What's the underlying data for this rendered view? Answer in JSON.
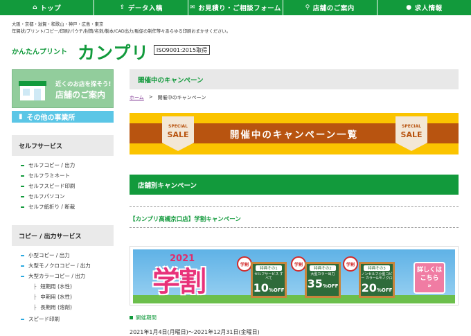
{
  "nav": [
    {
      "label": "トップ",
      "icon": "home-icon",
      "glyph": "⌂"
    },
    {
      "label": "データ入稿",
      "icon": "upload-icon",
      "glyph": "⇪"
    },
    {
      "label": "お見積り・ご相談フォーム",
      "icon": "mail-icon",
      "glyph": "✉"
    },
    {
      "label": "店舗のご案内",
      "icon": "search-icon",
      "glyph": "⚲"
    },
    {
      "label": "求人情報",
      "icon": "person-icon",
      "glyph": "●"
    }
  ],
  "header": {
    "tagline1": "大阪・京都・滋賀・和歌山・神戸・広島・東京",
    "tagline2": "年賀状/プリント/コピー/印刷/パウチ/封筒/名刺/製本/CAD出力/販促の制作等々あらゆる印刷おまかせください。",
    "brand_small": "かんたんプリント",
    "brand_big": "カンプリ",
    "iso": "ISO9001:2015取得"
  },
  "sidebar": {
    "store_banner_small": "近くのお店を探そう!",
    "store_banner_big": "店舗のご案内",
    "office_button": "その他の事業所",
    "self_service": {
      "heading": "セルフサービス",
      "items": [
        "セルフコピー / 出力",
        "セルフラミネート",
        "セルフスピード印刷",
        "セルフパソコン",
        "セルフ紙折り / 断裁"
      ]
    },
    "copy_output": {
      "heading": "コピー / 出力サービス",
      "items": [
        "小型コピー / 出力",
        "大型モノクロコピー / 出力",
        "大型カラーコピー / 出力"
      ],
      "subitems": [
        "短期用 (水性)",
        "中期用 (水性)",
        "長期用 (溶剤)"
      ],
      "after": [
        "スピード印刷"
      ]
    }
  },
  "main": {
    "heading": "開催中のキャンペーン",
    "breadcrumb_home": "ホーム",
    "breadcrumb_sep": ">",
    "breadcrumb_current": "開催中のキャンペーン",
    "banner_text": "開催中のキャンペーン一覧",
    "sale_tag_top": "SPECIAL",
    "sale_tag_main": "SALE",
    "store_campaigns_heading": "店舗別キャンペーン",
    "campaign_title": "【カンプリ高槻京口店】学割キャンペーン",
    "promo": {
      "year": "2021",
      "title": "学割",
      "seal": "学割",
      "boards": [
        {
          "tok": "特典その1",
          "desc": "セルフサービス すべて",
          "pct": "10",
          "unit": "%OFF"
        },
        {
          "tok": "特典その2",
          "desc": "大型カラー出力",
          "pct": "35",
          "unit": "%OFF"
        },
        {
          "tok": "特典その3",
          "desc": "ノンセルフ小型コピー カラー&モノクロ",
          "pct": "20",
          "unit": "%OFF"
        }
      ],
      "detail_line1": "詳しくは",
      "detail_line2": "こちら",
      "detail_arrow": "»"
    },
    "period_label": "開催期間",
    "period_dates": "2021年1月4日(月曜日)～2021年12月31日(金曜日)"
  },
  "colors": {
    "brand": "#129a3c",
    "banner_yellow": "#fbc400",
    "banner_band": "#b85410",
    "accent_pink": "#e8327a",
    "sky": "#5bc6e6"
  }
}
